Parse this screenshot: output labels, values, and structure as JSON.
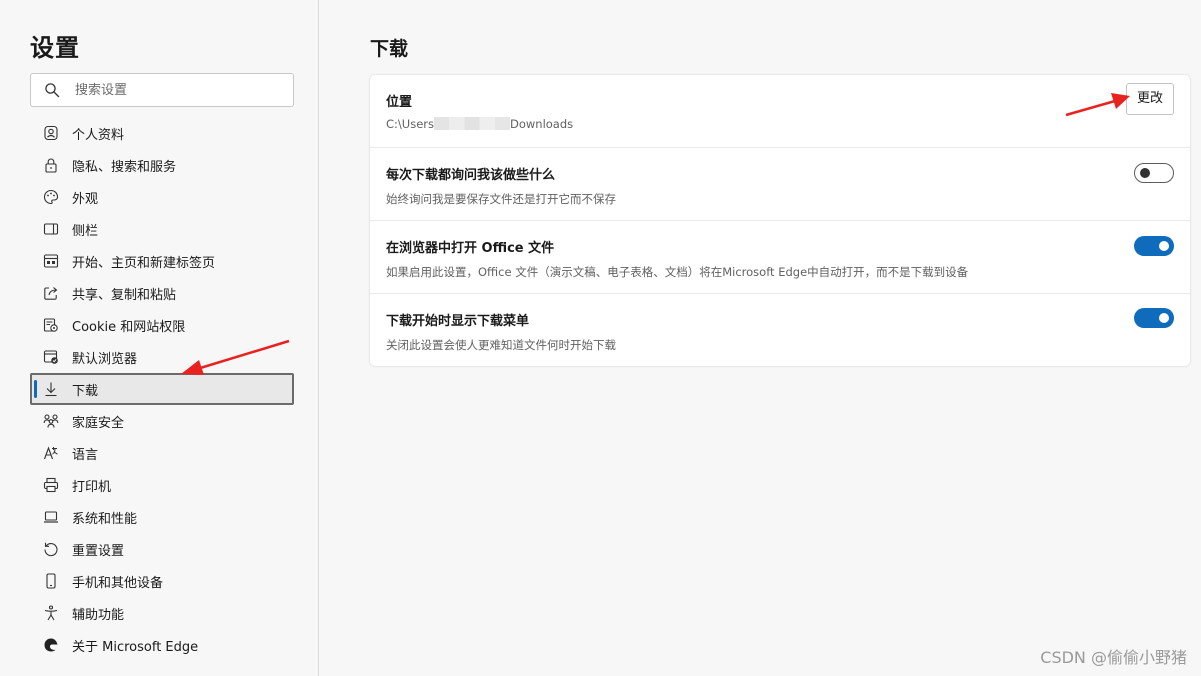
{
  "sidebar": {
    "title": "设置",
    "search_placeholder": "搜索设置",
    "items": [
      {
        "label": "个人资料",
        "icon": "profile-icon"
      },
      {
        "label": "隐私、搜索和服务",
        "icon": "lock-icon"
      },
      {
        "label": "外观",
        "icon": "palette-icon"
      },
      {
        "label": "侧栏",
        "icon": "sidebar-icon"
      },
      {
        "label": "开始、主页和新建标签页",
        "icon": "home-icon"
      },
      {
        "label": "共享、复制和粘贴",
        "icon": "share-icon"
      },
      {
        "label": "Cookie 和网站权限",
        "icon": "cookie-icon"
      },
      {
        "label": "默认浏览器",
        "icon": "default-browser-icon"
      },
      {
        "label": "下载",
        "icon": "download-icon",
        "selected": true
      },
      {
        "label": "家庭安全",
        "icon": "family-icon"
      },
      {
        "label": "语言",
        "icon": "language-icon"
      },
      {
        "label": "打印机",
        "icon": "printer-icon"
      },
      {
        "label": "系统和性能",
        "icon": "laptop-icon"
      },
      {
        "label": "重置设置",
        "icon": "reset-icon"
      },
      {
        "label": "手机和其他设备",
        "icon": "phone-icon"
      },
      {
        "label": "辅助功能",
        "icon": "accessibility-icon"
      },
      {
        "label": "关于 Microsoft Edge",
        "icon": "edge-icon"
      }
    ]
  },
  "main": {
    "title": "下载",
    "location": {
      "title": "位置",
      "path_prefix": "C:\\Users",
      "path_suffix": "Downloads",
      "change_label": "更改"
    },
    "settings": [
      {
        "title": "每次下载都询问我该做些什么",
        "desc": "始终询问我是要保存文件还是打开它而不保存",
        "enabled": false
      },
      {
        "title": "在浏览器中打开 Office 文件",
        "desc": "如果启用此设置，Office 文件（演示文稿、电子表格、文档）将在Microsoft Edge中自动打开，而不是下载到设备",
        "enabled": true
      },
      {
        "title": "下载开始时显示下载菜单",
        "desc": "关闭此设置会使人更难知道文件何时开始下载",
        "enabled": true
      }
    ]
  },
  "colors": {
    "accent": "#0f6cbd",
    "annotation_arrow": "#e8231f"
  },
  "watermark": "CSDN @偷偷小野猪"
}
